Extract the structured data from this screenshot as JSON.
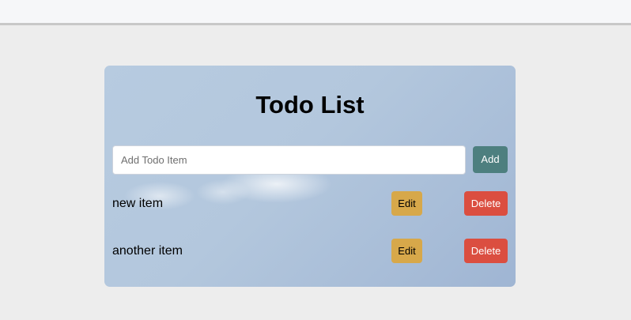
{
  "app": {
    "title": "Todo List"
  },
  "form": {
    "input_placeholder": "Add Todo Item",
    "input_value": "",
    "add_label": "Add"
  },
  "todos": [
    {
      "text": "new item",
      "edit_label": "Edit",
      "delete_label": "Delete"
    },
    {
      "text": "another item",
      "edit_label": "Edit",
      "delete_label": "Delete"
    }
  ],
  "colors": {
    "add_button": "#4d7f7f",
    "edit_button": "#d7a84a",
    "delete_button": "#db4e40",
    "page_background": "#ededed"
  }
}
